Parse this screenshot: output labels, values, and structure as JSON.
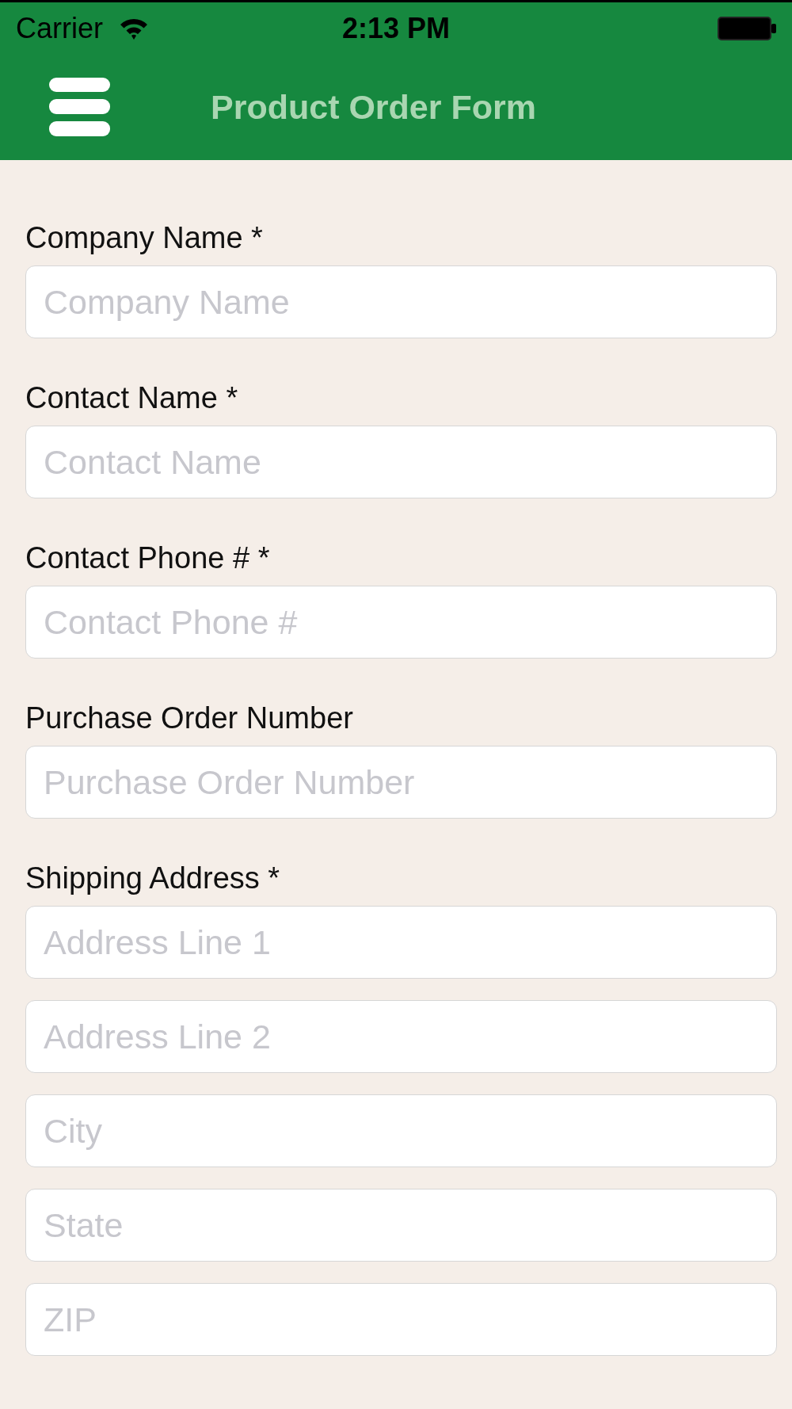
{
  "status_bar": {
    "carrier": "Carrier",
    "time": "2:13 PM"
  },
  "nav_bar": {
    "title": "Product Order Form"
  },
  "form": {
    "fields": [
      {
        "label": "Company Name *",
        "inputs": [
          {
            "placeholder": "Company Name"
          }
        ]
      },
      {
        "label": "Contact Name *",
        "inputs": [
          {
            "placeholder": "Contact Name"
          }
        ]
      },
      {
        "label": "Contact Phone # *",
        "inputs": [
          {
            "placeholder": "Contact Phone #"
          }
        ]
      },
      {
        "label": "Purchase Order Number",
        "inputs": [
          {
            "placeholder": "Purchase Order Number"
          }
        ]
      },
      {
        "label": "Shipping Address *",
        "inputs": [
          {
            "placeholder": "Address Line 1"
          },
          {
            "placeholder": "Address Line 2"
          },
          {
            "placeholder": "City"
          },
          {
            "placeholder": "State"
          },
          {
            "placeholder": "ZIP"
          }
        ]
      }
    ]
  }
}
